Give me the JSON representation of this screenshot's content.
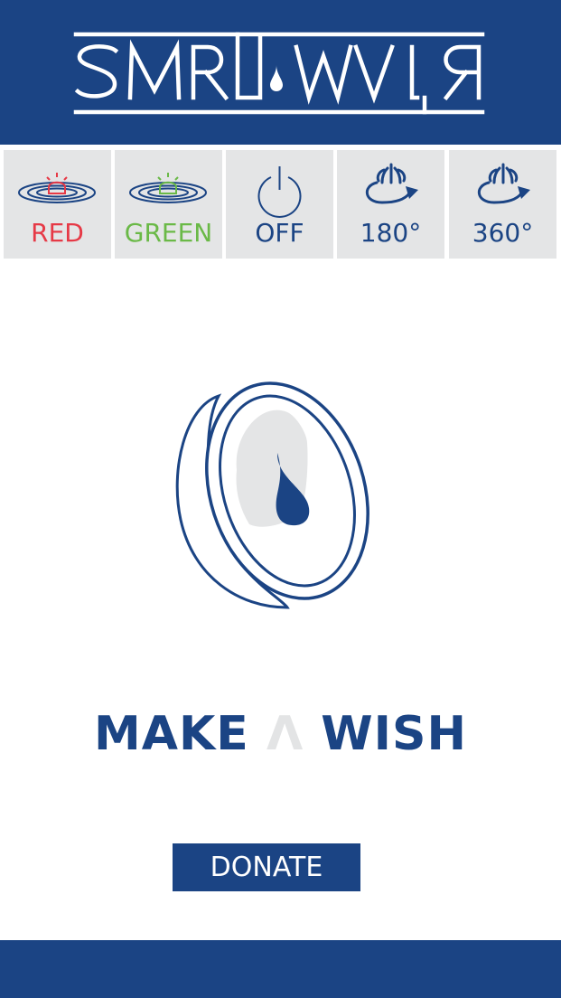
{
  "header": {
    "logo_text": "SMRT WATR",
    "background": "#1b4484"
  },
  "controls": [
    {
      "label": "RED",
      "icon": "red-light-icon",
      "color": "#e63946"
    },
    {
      "label": "GREEN",
      "icon": "green-light-icon",
      "color": "#6ab947"
    },
    {
      "label": "OFF",
      "icon": "power-icon",
      "color": "#1b4484"
    },
    {
      "label": "180°",
      "icon": "fountain-rotate-icon",
      "color": "#1b4484"
    },
    {
      "label": "360°",
      "icon": "fountain-rotate-icon",
      "color": "#1b4484"
    }
  ],
  "main": {
    "wish_left": "MAKE",
    "wish_mid": "Λ",
    "wish_right": "WISH",
    "coin_icon": "coin-with-water-drop-icon"
  },
  "donate_label": "DONATE",
  "colors": {
    "accent": "#1b4484",
    "panel": "#e4e5e6",
    "red": "#e63946",
    "green": "#6ab947"
  }
}
